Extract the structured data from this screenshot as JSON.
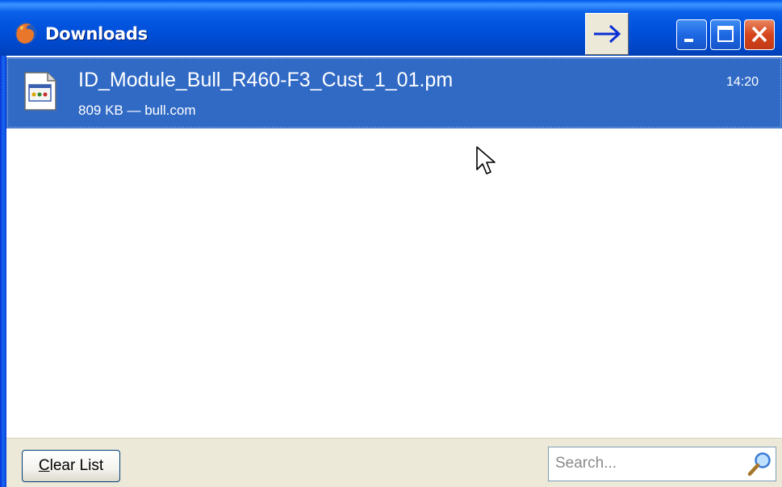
{
  "window": {
    "title": "Downloads",
    "app_icon": "firefox-icon",
    "controls": [
      "minimize-icon",
      "maximize-icon",
      "close-icon"
    ],
    "resize_button_icon": "arrow-right-icon"
  },
  "downloads": [
    {
      "filename": "ID_Module_Bull_R460-F3_Cust_1_01.pm",
      "detail": "809 KB — bull.com",
      "time": "14:20",
      "icon": "generic-file-icon",
      "selected": true
    }
  ],
  "footer": {
    "clear_mnemonic": "C",
    "clear_rest": "lear List",
    "search_placeholder": "Search..."
  },
  "colors": {
    "selection": "#316ac5",
    "titlebar": "#0052dd",
    "status_bg": "#ece9d8"
  }
}
